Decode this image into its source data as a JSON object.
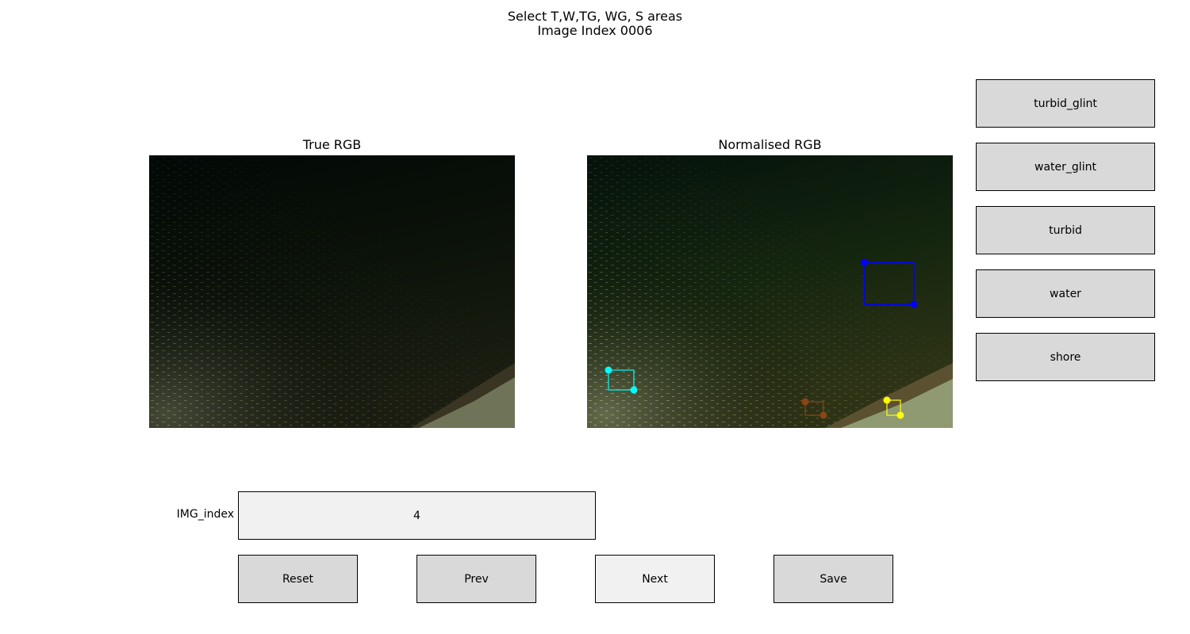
{
  "figure": {
    "title_line1": "Select T,W,TG, WG, S areas",
    "title_line2": "Image Index 0006"
  },
  "axes": {
    "left_title": "True RGB",
    "right_title": "Normalised RGB"
  },
  "class_buttons": {
    "turbid_glint": "turbid_glint",
    "water_glint": "water_glint",
    "turbid": "turbid",
    "water": "water",
    "shore": "shore"
  },
  "index_box": {
    "label": "IMG_index",
    "value": "4"
  },
  "nav_buttons": {
    "reset": "Reset",
    "prev": "Prev",
    "next": "Next",
    "save": "Save"
  },
  "selection_colors": {
    "turbid_glint": "#00ffff",
    "water": "#0000ff",
    "shore": "#8b4513",
    "turbid": "#ffff00"
  }
}
